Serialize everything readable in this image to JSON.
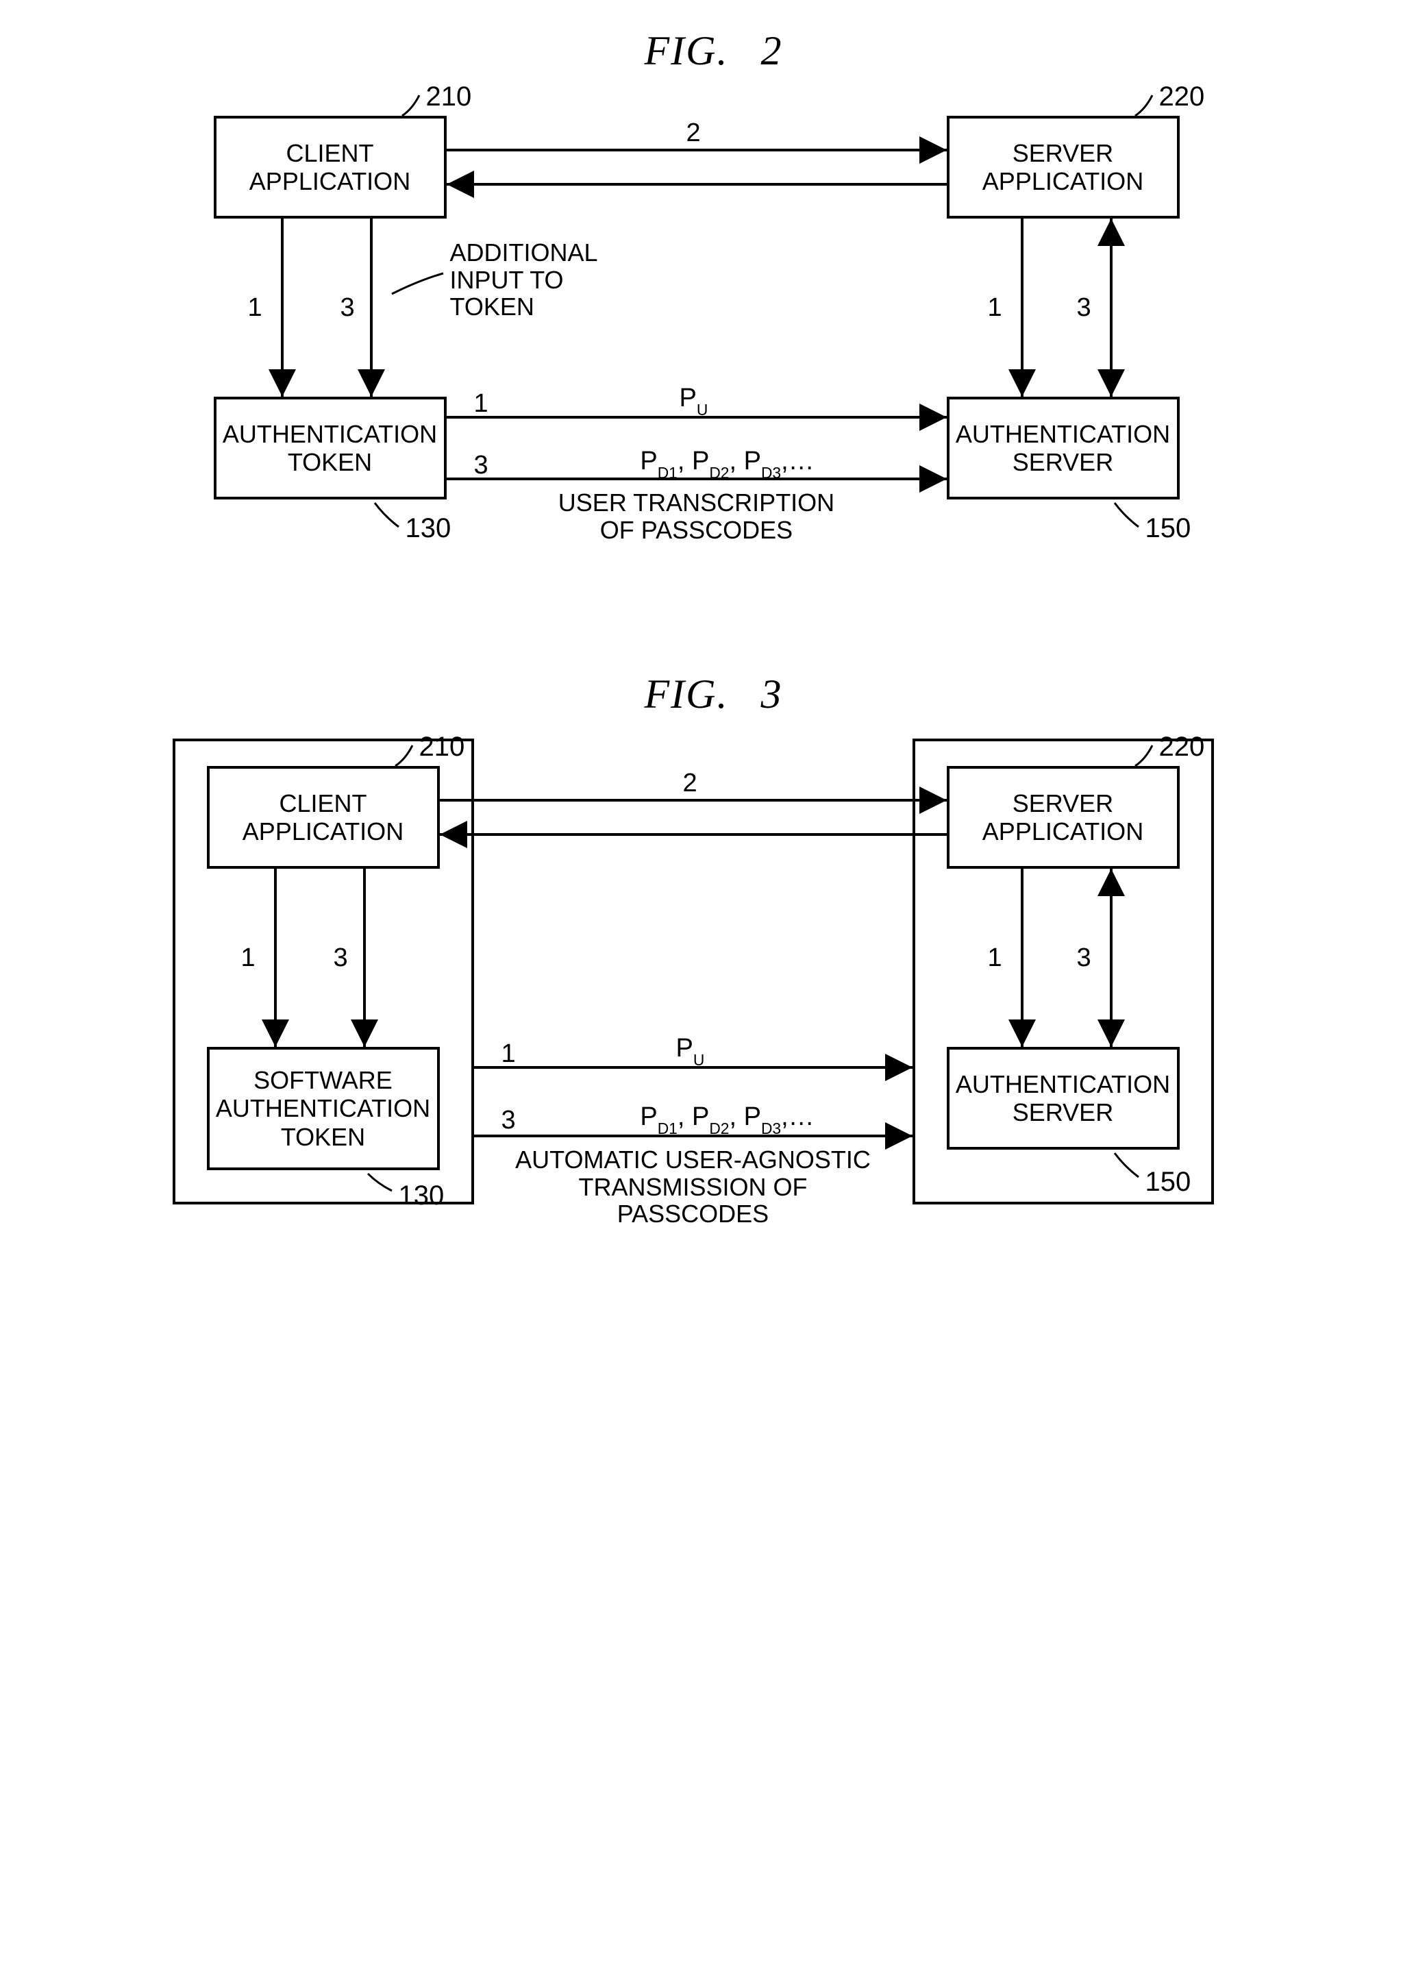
{
  "fig2": {
    "title": "FIG.  2",
    "boxes": {
      "client": "CLIENT\nAPPLICATION",
      "server": "SERVER\nAPPLICATION",
      "token": "AUTHENTICATION\nTOKEN",
      "auth": "AUTHENTICATION\nSERVER"
    },
    "refs": {
      "client": "210",
      "server": "220",
      "token": "130",
      "auth": "150"
    },
    "arrow_nums": {
      "top_bi": "2",
      "left_down1": "1",
      "left_down2": "3",
      "right_down1": "1",
      "right_up2": "3",
      "mid_top": "1",
      "mid_bot": "3"
    },
    "labels": {
      "additional_input": "ADDITIONAL\nINPUT TO\nTOKEN",
      "pu": "P",
      "pu_sub": "U",
      "pd_list_html": "P<span class='sub'>D1</span>, P<span class='sub'>D2</span>, P<span class='sub'>D3</span>,…",
      "bottom_caption": "USER TRANSCRIPTION\nOF PASSCODES"
    }
  },
  "fig3": {
    "title": "FIG.  3",
    "boxes": {
      "client": "CLIENT\nAPPLICATION",
      "server": "SERVER\nAPPLICATION",
      "token": "SOFTWARE\nAUTHENTICATION\nTOKEN",
      "auth": "AUTHENTICATION\nSERVER"
    },
    "refs": {
      "client": "210",
      "server": "220",
      "token": "130",
      "auth": "150"
    },
    "arrow_nums": {
      "top_bi": "2",
      "left_down1": "1",
      "left_down2": "3",
      "right_down1": "1",
      "right_up2": "3",
      "mid_top": "1",
      "mid_bot": "3"
    },
    "labels": {
      "pu": "P",
      "pu_sub": "U",
      "pd_list_html": "P<span class='sub'>D1</span>, P<span class='sub'>D2</span>, P<span class='sub'>D3</span>,…",
      "bottom_caption": "AUTOMATIC USER-AGNOSTIC\nTRANSMISSION OF PASSCODES"
    }
  }
}
